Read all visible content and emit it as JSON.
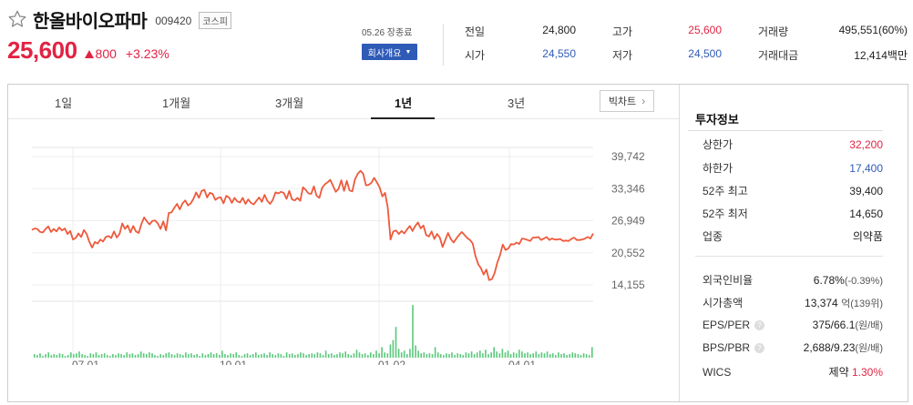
{
  "header": {
    "name": "한올바이오파마",
    "code": "009420",
    "market": "코스피",
    "price": "25,600",
    "change": "800",
    "change_pct": "+3.23%",
    "date_status": "05.26 장종료",
    "company_button": "회사개요"
  },
  "quotes": {
    "prev_close": {
      "label": "전일",
      "value": "24,800"
    },
    "high": {
      "label": "고가",
      "value": "25,600"
    },
    "volume": {
      "label": "거래량",
      "value": "495,551(60%)"
    },
    "open": {
      "label": "시가",
      "value": "24,550"
    },
    "low": {
      "label": "저가",
      "value": "24,500"
    },
    "trade_value": {
      "label": "거래대금",
      "value": "12,414백만"
    }
  },
  "tabs": [
    {
      "label": "1일"
    },
    {
      "label": "1개월"
    },
    {
      "label": "3개월"
    },
    {
      "label": "1년",
      "active": true
    },
    {
      "label": "3년"
    }
  ],
  "big_chart_label": "빅차트",
  "chart_data": {
    "type": "line",
    "y_ticks": [
      "39,742",
      "33,346",
      "26,949",
      "20,552",
      "14,155"
    ],
    "x_ticks": [
      "07.01",
      "10.01",
      "01.02",
      "04.01"
    ],
    "ylim": [
      14155,
      39742
    ],
    "line_color": "#ee5a3c",
    "volume_color": "#59c97a",
    "price": [
      25100,
      25400,
      25300,
      24700,
      24600,
      25300,
      25800,
      24700,
      25300,
      24800,
      25600,
      25000,
      25400,
      24300,
      24900,
      23200,
      23500,
      24400,
      23700,
      25100,
      24300,
      22700,
      21600,
      22700,
      22400,
      23200,
      22800,
      23700,
      23900,
      23500,
      24800,
      23600,
      24300,
      26400,
      25300,
      26000,
      24600,
      25900,
      24800,
      24500,
      26300,
      27600,
      26800,
      26200,
      26900,
      27000,
      26400,
      25300,
      26800,
      25000,
      28500,
      28600,
      29500,
      30300,
      29200,
      30400,
      31000,
      30000,
      30400,
      31300,
      32600,
      31500,
      32900,
      33100,
      31600,
      32500,
      32300,
      31100,
      31500,
      31600,
      30400,
      31900,
      31600,
      30500,
      31500,
      30800,
      30600,
      31500,
      30300,
      31200,
      30500,
      30200,
      30900,
      31600,
      30700,
      32100,
      30900,
      30300,
      31100,
      32600,
      32400,
      32700,
      32500,
      31300,
      32900,
      31200,
      31000,
      31500,
      30900,
      33600,
      33100,
      32400,
      32300,
      33800,
      31900,
      31500,
      33500,
      34200,
      34600,
      35100,
      33900,
      32700,
      33300,
      35000,
      32900,
      34900,
      33000,
      32800,
      35200,
      36300,
      36900,
      36300,
      34000,
      34100,
      34500,
      35500,
      34600,
      33600,
      31800,
      32500,
      29500,
      23200,
      24800,
      25000,
      24300,
      24900,
      24400,
      25200,
      25900,
      24900,
      25900,
      26600,
      25400,
      26000,
      24100,
      23800,
      24800,
      23300,
      24300,
      23600,
      21700,
      23100,
      24500,
      23300,
      22600,
      23400,
      24100,
      24700,
      24100,
      23500,
      23100,
      22400,
      19900,
      18300,
      17500,
      16200,
      17200,
      15100,
      15300,
      16500,
      18600,
      20100,
      22200,
      21100,
      21400,
      22300,
      22200,
      22600,
      22300,
      23400,
      23300,
      23100,
      22900,
      23600,
      23600,
      23700,
      23100,
      23400,
      23700,
      23100,
      23400,
      23200,
      23200,
      23300,
      22900,
      23000,
      22900,
      23300,
      23600,
      23100,
      23100,
      23200,
      23400,
      23700,
      23400,
      24400
    ],
    "volume": [
      4,
      3,
      5,
      2,
      4,
      6,
      3,
      4,
      3,
      5,
      4,
      2,
      3,
      6,
      4,
      5,
      7,
      4,
      3,
      2,
      5,
      4,
      6,
      3,
      4,
      5,
      3,
      2,
      4,
      3,
      5,
      4,
      3,
      6,
      4,
      5,
      3,
      4,
      7,
      5,
      4,
      6,
      5,
      3,
      2,
      4,
      3,
      5,
      6,
      4,
      3,
      5,
      4,
      3,
      6,
      4,
      5,
      3,
      4,
      2,
      5,
      3,
      4,
      6,
      4,
      5,
      3,
      8,
      4,
      3,
      5,
      4,
      6,
      3,
      2,
      4,
      5,
      3,
      4,
      6,
      3,
      4,
      5,
      3,
      6,
      4,
      3,
      5,
      4,
      2,
      6,
      4,
      5,
      3,
      4,
      6,
      5,
      3,
      4,
      5,
      4,
      6,
      5,
      3,
      8,
      4,
      5,
      3,
      4,
      6,
      5,
      7,
      4,
      3,
      5,
      9,
      6,
      4,
      5,
      3,
      6,
      4,
      8,
      5,
      12,
      6,
      5,
      15,
      20,
      35,
      10,
      6,
      8,
      4,
      10,
      60,
      14,
      8,
      5,
      6,
      4,
      5,
      4,
      12,
      6,
      4,
      3,
      5,
      4,
      6,
      3,
      5,
      4,
      3,
      6,
      5,
      7,
      4,
      6,
      8,
      5,
      9,
      4,
      6,
      12,
      7,
      5,
      10,
      6,
      8,
      4,
      6,
      5,
      9,
      7,
      5,
      6,
      4,
      5,
      7,
      4,
      6,
      5,
      7,
      4,
      5,
      3,
      6,
      4,
      5,
      3,
      4,
      6,
      5,
      4,
      3,
      5,
      4,
      3,
      12
    ]
  },
  "investment": {
    "title": "투자정보",
    "rows1": [
      {
        "k": "상한가",
        "v": "32,200",
        "color": "#e12343"
      },
      {
        "k": "하한가",
        "v": "17,400",
        "color": "#2f5bb7"
      },
      {
        "k": "52주 최고",
        "v": "39,400",
        "color": "#222"
      },
      {
        "k": "52주 최저",
        "v": "14,650",
        "color": "#222"
      },
      {
        "k": "업종",
        "v": "의약품",
        "color": "#222"
      }
    ],
    "foreign": {
      "k": "외국인비율",
      "v": "6.78%",
      "sub": "(-0.39%)"
    },
    "market_cap": {
      "k": "시가총액",
      "v": "13,374",
      "sub": "억(139위)"
    },
    "eps_per": {
      "k": "EPS/PER",
      "v": "375/66.1",
      "sub": "(원/배)"
    },
    "bps_pbr": {
      "k": "BPS/PBR",
      "v": "2,688/9.23",
      "sub": "(원/배)"
    },
    "wics": {
      "k": "WICS",
      "v": "제약",
      "pct": "1.30%"
    }
  }
}
